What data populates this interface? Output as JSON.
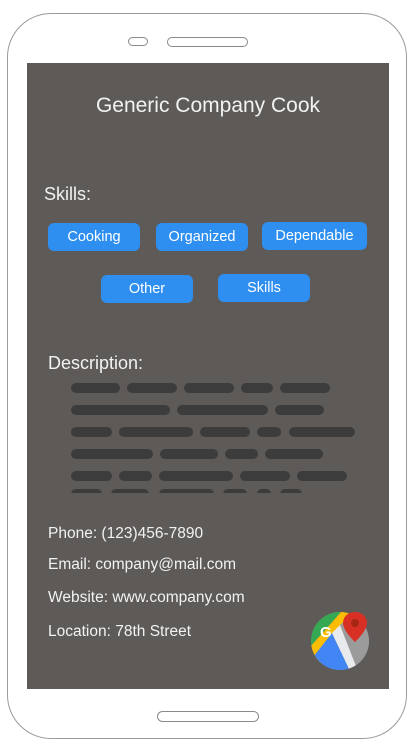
{
  "profile": {
    "title": "Generic Company Cook",
    "skills_label": "Skills:",
    "skills": [
      "Cooking",
      "Organized",
      "Dependable",
      "Other",
      "Skills"
    ],
    "description_label": "Description:",
    "phone": "Phone: (123)456-7890",
    "email": "Email: company@mail.com",
    "website": "Website: www.company.com",
    "location": "Location: 78th Street"
  },
  "icons": {
    "maps": "google-maps-icon"
  },
  "colors": {
    "screen_background": "#5e5a58",
    "chip_background": "#2e8ff0",
    "text": "#f2f2f2",
    "placeholder_text": "#3c3c3c"
  }
}
